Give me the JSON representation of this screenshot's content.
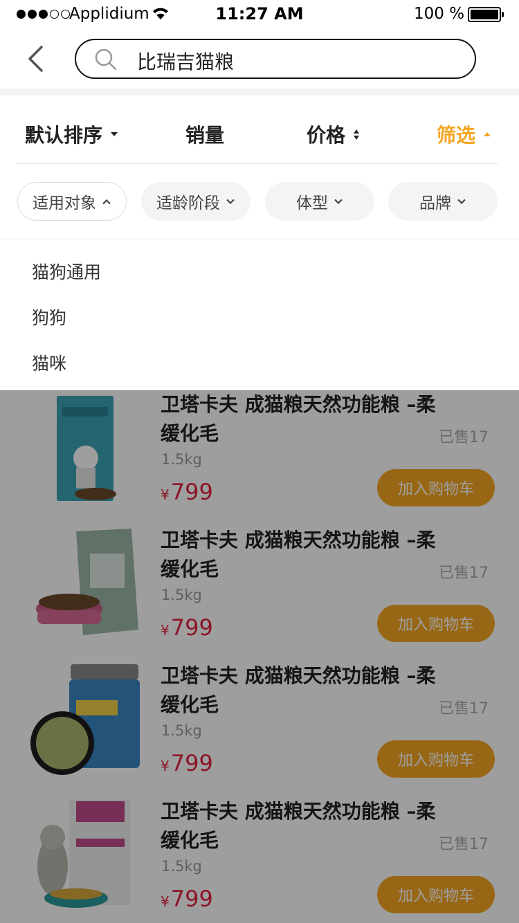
{
  "status_bar": {
    "carrier": "Applidium",
    "time": "11:27 AM",
    "battery": "100 %"
  },
  "search": {
    "query": "比瑞吉猫粮"
  },
  "sort": {
    "default": "默认排序",
    "sales": "销量",
    "price": "价格",
    "filter": "筛选"
  },
  "filters": [
    {
      "label": "适用对象",
      "expanded": true
    },
    {
      "label": "适龄阶段",
      "expanded": false
    },
    {
      "label": "体型",
      "expanded": false
    },
    {
      "label": "品牌",
      "expanded": false
    }
  ],
  "dropdown_options": [
    "猫狗通用",
    "狗狗",
    "猫咪"
  ],
  "products": [
    {
      "title": "卫塔卡夫 成猫粮天然功能粮 –柔缓化毛",
      "sold": "已售17",
      "weight": "1.5kg",
      "currency": "¥",
      "price": "799",
      "cart": "加入购物车"
    },
    {
      "title": "卫塔卡夫 成猫粮天然功能粮 –柔缓化毛",
      "sold": "已售17",
      "weight": "1.5kg",
      "currency": "¥",
      "price": "799",
      "cart": "加入购物车"
    },
    {
      "title": "卫塔卡夫 成猫粮天然功能粮 –柔缓化毛",
      "sold": "已售17",
      "weight": "1.5kg",
      "currency": "¥",
      "price": "799",
      "cart": "加入购物车"
    },
    {
      "title": "卫塔卡夫 成猫粮天然功能粮 –柔缓化毛",
      "sold": "已售17",
      "weight": "1.5kg",
      "currency": "¥",
      "price": "799",
      "cart": "加入购物车"
    }
  ],
  "colors": {
    "accent": "#f5a623",
    "price": "#e2233f",
    "overlay": "rgba(0,0,0,0.38)"
  }
}
